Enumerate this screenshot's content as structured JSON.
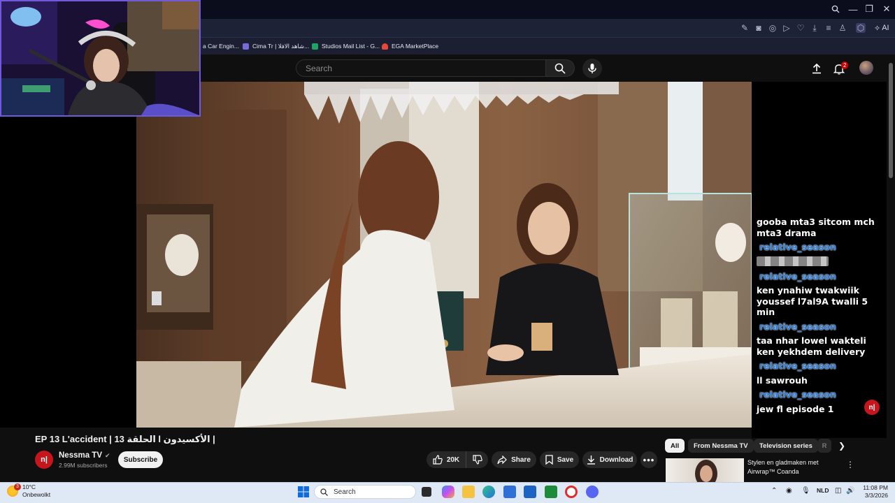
{
  "browser": {
    "ai_label": "AI",
    "bookmarks": [
      {
        "label": "a Car Engin...",
        "color": "#1e2236"
      },
      {
        "label": "Cima Tr | شاهد الافلا...",
        "color": "#7a6ad8"
      },
      {
        "label": "Studios Mail List - G...",
        "color": "#1fa463"
      },
      {
        "label": "EGA MarketPlace",
        "color": "#e5473b"
      }
    ]
  },
  "youtube": {
    "search_placeholder": "Search",
    "notification_count": "2",
    "video_title": "EP 13 L'accident | الحلقة 13 l الأكسيدون |",
    "channel": {
      "name": "Nessma TV",
      "subscribers": "2.99M subscribers",
      "logo_text": "n|"
    },
    "subscribe_label": "Subscribe",
    "actions": {
      "likes": "20K",
      "share": "Share",
      "save": "Save",
      "download": "Download"
    },
    "chips": [
      "All",
      "From Nessma TV",
      "Television series",
      "R"
    ],
    "ad": {
      "title": "Stylen en gladmaken met Airwrap™ Coanda"
    }
  },
  "chat": {
    "messages": [
      {
        "type": "msg",
        "text": "gooba mta3 sitcom mch mta3 drama"
      },
      {
        "type": "user",
        "text": "relative_season"
      },
      {
        "type": "blur",
        "text": ""
      },
      {
        "type": "user",
        "text": "relative_season"
      },
      {
        "type": "msg",
        "text": "ken ynahiw twakwiik youssef l7al9A twalli 5 min"
      },
      {
        "type": "user",
        "text": "relative_season"
      },
      {
        "type": "msg",
        "text": "taa nhar lowel wakteli ken yekhdem delivery"
      },
      {
        "type": "user",
        "text": "relative_season"
      },
      {
        "type": "msg",
        "text": "ll sawrouh"
      },
      {
        "type": "user",
        "text": "relative_season"
      },
      {
        "type": "msg",
        "text": "jew fl episode 1"
      }
    ]
  },
  "taskbar": {
    "weather_badge": "3",
    "temperature": "10°C",
    "condition": "Onbewolkt",
    "search_label": "Search",
    "language": "NLD",
    "time": "11:08 PM",
    "date": "3/3/2026",
    "apps": [
      {
        "name": "task-view",
        "color": "#2b2b2b"
      },
      {
        "name": "copilot",
        "color": "#3a8ee6"
      },
      {
        "name": "file-explorer",
        "color": "#f5c342"
      },
      {
        "name": "edge",
        "color": "#1fa0a8"
      },
      {
        "name": "store",
        "color": "#2f6fd6"
      },
      {
        "name": "outlook",
        "color": "#1d63c4"
      },
      {
        "name": "app-green",
        "color": "#1d8c3a"
      },
      {
        "name": "opera",
        "color": "#e22c2c"
      },
      {
        "name": "discord",
        "color": "#5865f2"
      }
    ]
  }
}
